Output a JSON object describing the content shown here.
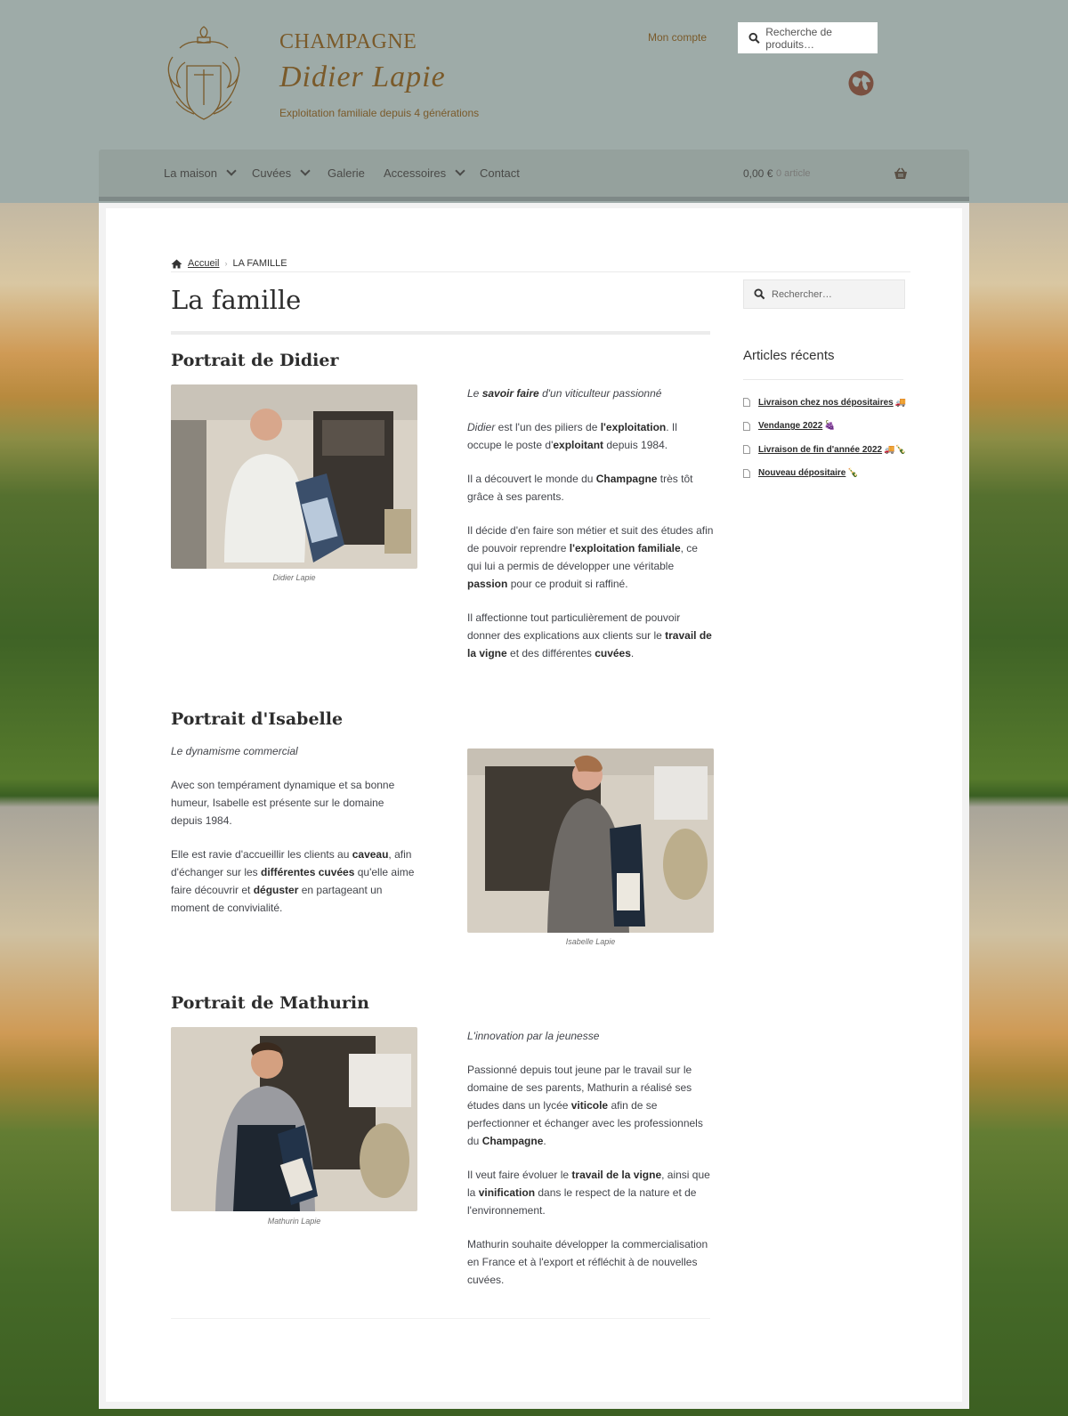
{
  "header": {
    "brand_top": "CHAMPAGNE",
    "brand_name": "Didier  Lapie",
    "tagline": "Exploitation familiale depuis 4 générations",
    "account_link": "Mon compte",
    "search_placeholder": "Recherche de produits…",
    "colors": {
      "band": "#9eaba8",
      "brand": "#7a5a2a"
    }
  },
  "nav": {
    "items": [
      {
        "label": "La maison",
        "has_dropdown": true
      },
      {
        "label": "Cuvées",
        "has_dropdown": true
      },
      {
        "label": "Galerie",
        "has_dropdown": false
      },
      {
        "label": "Accessoires",
        "has_dropdown": true
      },
      {
        "label": "Contact",
        "has_dropdown": false
      }
    ],
    "cart_amount": "0,00 €",
    "cart_count": "0 article"
  },
  "breadcrumb": {
    "home": "Accueil",
    "current": "LA FAMILLE"
  },
  "page_title": "La famille",
  "sections": [
    {
      "heading": "Portrait de Didier",
      "caption": "Didier Lapie",
      "paragraphs": [
        "<i>Le <b>savoir faire</b> d'un viticulteur passionné</i>",
        "<i>Didier</i> est l'un des piliers de <b>l'exploitation</b>. Il occupe le poste d'<b>exploitant</b> depuis 1984.",
        "Il a découvert le monde du <b>Champagne</b> très tôt grâce à ses parents.",
        "Il décide d'en faire son métier et suit des études afin de pouvoir reprendre <b>l'exploitation familiale</b>, ce qui lui a permis de développer une véritable <b>passion</b> pour ce produit si raffiné.",
        "Il affectionne tout particulièrement de pouvoir donner des explications aux clients sur le <b>travail de la vigne</b> et des différentes <b>cuvées</b>."
      ]
    },
    {
      "heading": "Portrait d'Isabelle",
      "caption": "Isabelle Lapie",
      "paragraphs": [
        "<i>Le dynamisme commercial</i>",
        "Avec son tempérament dynamique et sa bonne humeur, Isabelle est présente sur le domaine depuis 1984.",
        "Elle est ravie d'accueillir les clients au <b>caveau</b>, afin d'échanger sur les <b>différentes cuvées</b> qu'elle aime faire découvrir et <b>déguster</b> en partageant un moment de convivialité."
      ]
    },
    {
      "heading": "Portrait de Mathurin",
      "caption": "Mathurin Lapie",
      "paragraphs": [
        "<i>L'innovation par la jeunesse</i>",
        "Passionné depuis tout jeune par le travail sur le domaine de ses parents, Mathurin a réalisé ses études dans un lycée <b>viticole</b> afin de se perfectionner et échanger avec les professionnels du <b>Champagne</b>.",
        "Il veut faire évoluer le <b>travail de la vigne</b>, ainsi que la <b>vinification</b> dans le respect de la nature et de l'environnement.",
        "Mathurin souhaite développer la commercialisation en France et à l'export et réfléchit à de nouvelles cuvées."
      ]
    }
  ],
  "sidebar": {
    "search_placeholder": "Rechercher…",
    "recent_heading": "Articles récents",
    "recent_posts": [
      {
        "title": "Livraison chez nos dépositaires",
        "emoji": "🚚"
      },
      {
        "title": "Vendange 2022",
        "emoji": "🍇"
      },
      {
        "title": "Livraison de fin d'année 2022",
        "emoji": "🚚🍾"
      },
      {
        "title": "Nouveau dépositaire",
        "emoji": "🍾"
      }
    ]
  }
}
